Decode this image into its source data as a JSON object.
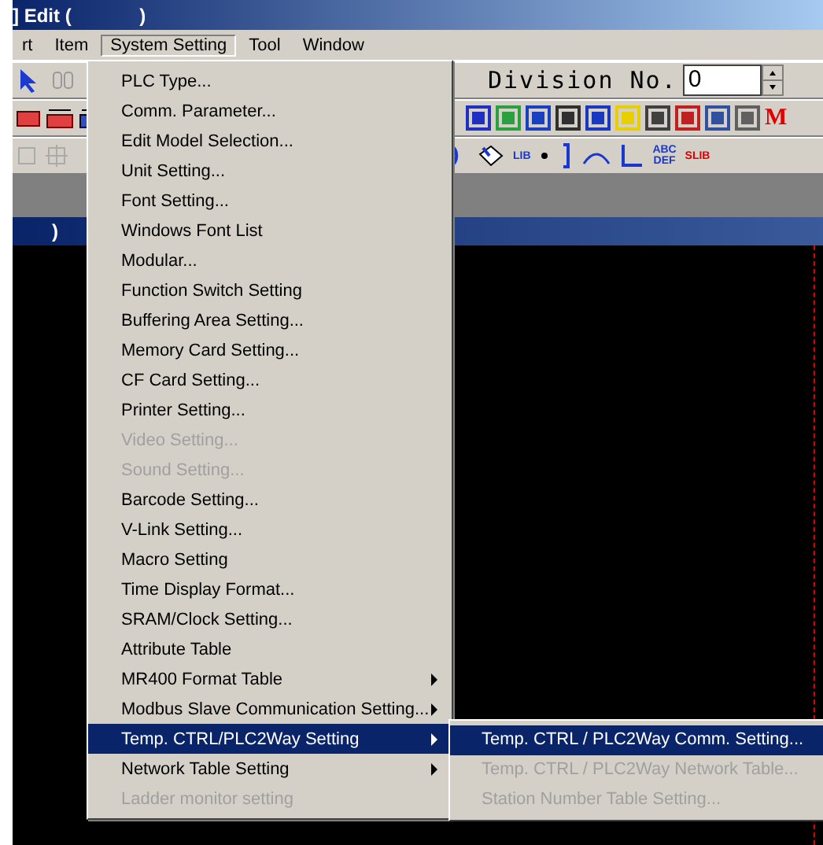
{
  "window": {
    "title": "] Edit (             )"
  },
  "menu_bar": [
    {
      "label": "rt",
      "selected": false
    },
    {
      "label": "Item",
      "selected": false
    },
    {
      "label": "System Setting",
      "selected": true
    },
    {
      "label": "Tool",
      "selected": false
    },
    {
      "label": "Window",
      "selected": false
    }
  ],
  "toolbar": {
    "division_label": "Division No.",
    "division_value": "0",
    "m_label": "M",
    "lib_label": "LIB",
    "abc_label": "ABC DEF",
    "slib_label": "SLIB"
  },
  "child_window": {
    "title": ")"
  },
  "menu": [
    {
      "label": "PLC Type...",
      "disabled": false,
      "submenu": false,
      "selected": false
    },
    {
      "label": "Comm. Parameter...",
      "disabled": false,
      "submenu": false,
      "selected": false
    },
    {
      "label": "Edit Model Selection...",
      "disabled": false,
      "submenu": false,
      "selected": false
    },
    {
      "label": "Unit Setting...",
      "disabled": false,
      "submenu": false,
      "selected": false
    },
    {
      "label": "Font Setting...",
      "disabled": false,
      "submenu": false,
      "selected": false
    },
    {
      "label": "Windows Font List",
      "disabled": false,
      "submenu": false,
      "selected": false
    },
    {
      "label": "Modular...",
      "disabled": false,
      "submenu": false,
      "selected": false
    },
    {
      "label": "Function Switch Setting",
      "disabled": false,
      "submenu": false,
      "selected": false
    },
    {
      "label": "Buffering Area Setting...",
      "disabled": false,
      "submenu": false,
      "selected": false
    },
    {
      "label": "Memory Card Setting...",
      "disabled": false,
      "submenu": false,
      "selected": false
    },
    {
      "label": "CF Card Setting...",
      "disabled": false,
      "submenu": false,
      "selected": false
    },
    {
      "label": "Printer Setting...",
      "disabled": false,
      "submenu": false,
      "selected": false
    },
    {
      "label": "Video Setting...",
      "disabled": true,
      "submenu": false,
      "selected": false
    },
    {
      "label": "Sound Setting...",
      "disabled": true,
      "submenu": false,
      "selected": false
    },
    {
      "label": "Barcode Setting...",
      "disabled": false,
      "submenu": false,
      "selected": false
    },
    {
      "label": "V-Link Setting...",
      "disabled": false,
      "submenu": false,
      "selected": false
    },
    {
      "label": "Macro Setting",
      "disabled": false,
      "submenu": false,
      "selected": false
    },
    {
      "label": "Time Display Format...",
      "disabled": false,
      "submenu": false,
      "selected": false
    },
    {
      "label": "SRAM/Clock Setting...",
      "disabled": false,
      "submenu": false,
      "selected": false
    },
    {
      "label": "Attribute Table",
      "disabled": false,
      "submenu": false,
      "selected": false
    },
    {
      "label": "MR400 Format Table",
      "disabled": false,
      "submenu": true,
      "selected": false
    },
    {
      "label": "Modbus Slave Communication Setting...",
      "disabled": false,
      "submenu": true,
      "selected": false
    },
    {
      "label": "Temp. CTRL/PLC2Way Setting",
      "disabled": false,
      "submenu": true,
      "selected": true
    },
    {
      "label": "Network Table Setting",
      "disabled": false,
      "submenu": true,
      "selected": false
    },
    {
      "label": "Ladder monitor setting",
      "disabled": true,
      "submenu": false,
      "selected": false
    }
  ],
  "submenu": [
    {
      "label": "Temp. CTRL / PLC2Way Comm. Setting...",
      "disabled": false,
      "selected": true
    },
    {
      "label": "Temp. CTRL / PLC2Way Network Table...",
      "disabled": true,
      "selected": false
    },
    {
      "label": "Station Number Table Setting...",
      "disabled": true,
      "selected": false
    }
  ]
}
